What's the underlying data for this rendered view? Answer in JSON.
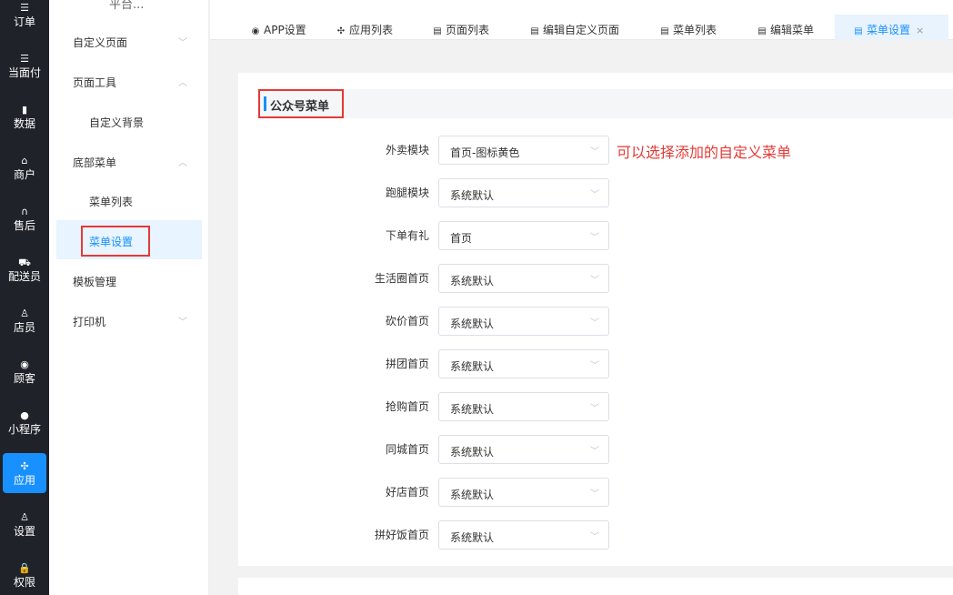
{
  "rail": [
    {
      "icon": "☰",
      "icon_name": "list-icon",
      "label": "订单"
    },
    {
      "icon": "☰",
      "icon_name": "list-icon",
      "label": "当面付"
    },
    {
      "icon": "▮",
      "icon_name": "bar-chart-icon",
      "label": "数据"
    },
    {
      "icon": "⌂",
      "icon_name": "store-icon",
      "label": "商户"
    },
    {
      "icon": "∩",
      "icon_name": "headset-icon",
      "label": "售后"
    },
    {
      "icon": "⛟",
      "icon_name": "delivery-icon",
      "label": "配送员"
    },
    {
      "icon": "♙",
      "icon_name": "staff-icon",
      "label": "店员"
    },
    {
      "icon": "◉",
      "icon_name": "customer-icon",
      "label": "顾客"
    },
    {
      "icon": "●",
      "icon_name": "wechat-icon",
      "label": "小程序"
    },
    {
      "icon": "✣",
      "icon_name": "apps-icon",
      "label": "应用"
    },
    {
      "icon": "♙",
      "icon_name": "settings-user-icon",
      "label": "设置"
    },
    {
      "icon": "🔒",
      "icon_name": "lock-icon",
      "label": "权限"
    }
  ],
  "submenu": {
    "title": "平台...",
    "items": {
      "custom_page": "自定义页面",
      "page_tools": "页面工具",
      "custom_bg": "自定义背景",
      "bottom_menu": "底部菜单",
      "menu_list": "菜单列表",
      "menu_settings": "菜单设置",
      "template_mgmt": "模板管理",
      "printer": "打印机"
    },
    "chevron_down": "﹀",
    "chevron_up": "︿"
  },
  "tabs": [
    {
      "icon": "◉",
      "icon_name": "app-icon",
      "label": "APP设置"
    },
    {
      "icon": "✣",
      "icon_name": "grid-icon",
      "label": "应用列表"
    },
    {
      "icon": "▤",
      "icon_name": "page-icon",
      "label": "页面列表"
    },
    {
      "icon": "▤",
      "icon_name": "page-icon",
      "label": "编辑自定义页面"
    },
    {
      "icon": "▤",
      "icon_name": "page-icon",
      "label": "菜单列表"
    },
    {
      "icon": "▤",
      "icon_name": "page-icon",
      "label": "编辑菜单"
    },
    {
      "icon": "▤",
      "icon_name": "page-icon",
      "label": "菜单设置",
      "close": "×"
    }
  ],
  "section": {
    "title": "公众号菜单"
  },
  "form": [
    {
      "label": "外卖模块",
      "value": "首页-图标黄色"
    },
    {
      "label": "跑腿模块",
      "value": "系统默认"
    },
    {
      "label": "下单有礼",
      "value": "首页"
    },
    {
      "label": "生活圈首页",
      "value": "系统默认"
    },
    {
      "label": "砍价首页",
      "value": "系统默认"
    },
    {
      "label": "拼团首页",
      "value": "系统默认"
    },
    {
      "label": "抢购首页",
      "value": "系统默认"
    },
    {
      "label": "同城首页",
      "value": "系统默认"
    },
    {
      "label": "好店首页",
      "value": "系统默认"
    },
    {
      "label": "拼好饭首页",
      "value": "系统默认"
    }
  ],
  "select_arrow": "﹀",
  "annotation": "可以选择添加的自定义菜单",
  "colors": {
    "accent": "#1890ff",
    "highlight": "#e53935",
    "rail_bg": "#1f2229"
  }
}
